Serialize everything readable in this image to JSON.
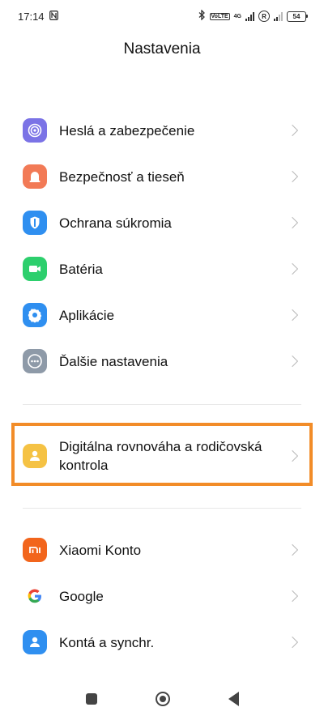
{
  "status_bar": {
    "time": "17:14",
    "nfc_icon": "nfc-icon",
    "bluetooth_icon": "bluetooth-icon",
    "volte": "VoLTE",
    "network": "4G",
    "roaming": "R",
    "battery": "54"
  },
  "header": {
    "title": "Nastavenia"
  },
  "groups": [
    {
      "items": [
        {
          "label": "Heslá a zabezpečenie",
          "icon": "fingerprint-icon",
          "color": "#7b73e6"
        },
        {
          "label": "Bezpečnosť a tieseň",
          "icon": "alarm-icon",
          "color": "#f27a56"
        },
        {
          "label": "Ochrana súkromia",
          "icon": "privacy-icon",
          "color": "#2f8ff0"
        },
        {
          "label": "Batéria",
          "icon": "battery-icon",
          "color": "#2dcf6d"
        },
        {
          "label": "Aplikácie",
          "icon": "gear-icon",
          "color": "#2f8ff0"
        },
        {
          "label": "Ďalšie nastavenia",
          "icon": "more-icon",
          "color": "#8e9aa8"
        }
      ]
    },
    {
      "items": [
        {
          "label": "Digitálna rovnováha a rodičovská kontrola",
          "icon": "family-icon",
          "color": "#f5c244",
          "highlighted": true
        }
      ]
    },
    {
      "items": [
        {
          "label": "Xiaomi Konto",
          "icon": "mi-icon",
          "color": "#f2651c"
        },
        {
          "label": "Google",
          "icon": "google-icon",
          "color": "#ffffff"
        },
        {
          "label": "Kontá a synchr.",
          "icon": "account-icon",
          "color": "#2f8ff0"
        }
      ]
    }
  ],
  "highlight_color": "#f28c28",
  "navbar": {
    "recents": "recents-icon",
    "home": "home-icon",
    "back": "back-icon"
  }
}
